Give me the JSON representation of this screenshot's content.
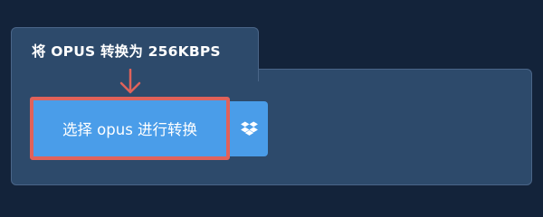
{
  "section": {
    "tab_title": "将 OPUS 转换为 256KBPS"
  },
  "actions": {
    "choose_file_label": "选择 opus 进行转换",
    "dropbox_icon": "dropbox-icon"
  },
  "colors": {
    "page_background": "#13233a",
    "panel_background": "#2d4a6b",
    "panel_border": "#4a6588",
    "button_primary": "#4a9de9",
    "highlight_annotation": "#e0625a",
    "text": "#ffffff"
  }
}
